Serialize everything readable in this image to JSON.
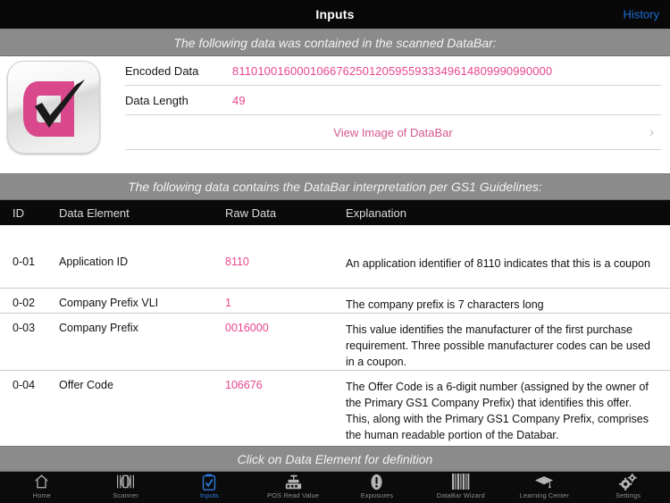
{
  "navbar": {
    "title": "Inputs",
    "right_link": "History",
    "right_link_color": "#1d6fd6"
  },
  "bands": {
    "top": "The following data was contained in the scanned DataBar:",
    "middle": "The following data contains the DataBar interpretation per GS1 Guidelines:",
    "bottom": "Click on Data Element for definition"
  },
  "summary": {
    "app_icon_name": "coupon-check-app-icon",
    "rows": [
      {
        "key": "Encoded Data",
        "value": "8110100160001066762501205955933349614809990990000"
      },
      {
        "key": "Data Length",
        "value": "49"
      }
    ],
    "view_image_label": "View Image of DataBar",
    "chevron": "›"
  },
  "table": {
    "headers": {
      "id": "ID",
      "data_element": "Data Element",
      "raw_data": "Raw Data",
      "explanation": "Explanation"
    },
    "rows": [
      {
        "id": "0-01",
        "data_element": "Application ID",
        "raw_data": "8110",
        "explanation": "An application identifier of 8110 indicates that this is a coupon"
      },
      {
        "id": "0-02",
        "data_element": "Company Prefix VLI",
        "raw_data": "1",
        "explanation": "The company prefix is 7 characters long"
      },
      {
        "id": "0-03",
        "data_element": "Company Prefix",
        "raw_data": "0016000",
        "explanation": "This value identifies the manufacturer of the first purchase requirement.  Three possible manufacturer codes can be used in a coupon."
      },
      {
        "id": "0-04",
        "data_element": "Offer Code",
        "raw_data": "106676",
        "explanation": "The Offer Code is a 6-digit number (assigned by the owner of the Primary GS1 Company Prefix) that identifies this offer.  This, along with the Primary GS1 Company Prefix, comprises the human readable portion of the Databar."
      }
    ]
  },
  "tabbar": {
    "active_index": 2,
    "items": [
      {
        "label": "Home",
        "icon": "home-icon"
      },
      {
        "label": "Scanner",
        "icon": "scanner-icon"
      },
      {
        "label": "Inputs",
        "icon": "clipboard-check-icon"
      },
      {
        "label": "POS Read Value",
        "icon": "cash-register-icon"
      },
      {
        "label": "Exposures",
        "icon": "exclamation-circle-icon"
      },
      {
        "label": "DataBar Wizard",
        "icon": "barcode-icon"
      },
      {
        "label": "Learning Center",
        "icon": "graduation-cap-icon"
      },
      {
        "label": "Settings",
        "icon": "gears-icon"
      }
    ]
  },
  "colors": {
    "accent_pink": "#e8468c",
    "band_gray": "#8b8b8b",
    "bar_black": "#0a0a0a",
    "link_blue": "#1d6fd6",
    "active_tab_blue": "#2b7ce0"
  }
}
